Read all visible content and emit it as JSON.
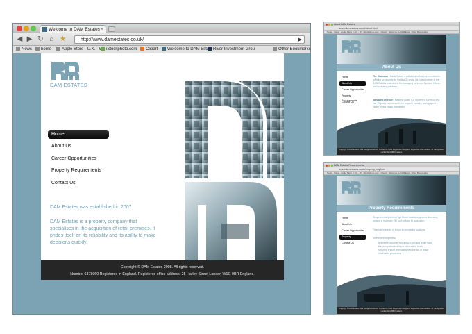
{
  "browser": {
    "tab_title": "Welcome to DAM Estates",
    "url": "http://www.damestates.co.uk/",
    "bookmarks": [
      "News",
      "home",
      "Apple Store - U.K. - W",
      "iStockphoto.com",
      "Clipart",
      "Welcome to DAM Esta",
      "River Investment Grou",
      "Other Bookmarks"
    ]
  },
  "site": {
    "logo_text": "DAM ESTATES",
    "nav": [
      {
        "label": "Home",
        "active": true
      },
      {
        "label": "About Us"
      },
      {
        "label": "Career Opportunities"
      },
      {
        "label": "Property Requirements"
      },
      {
        "label": "Contact Us"
      }
    ],
    "established": "DAM Estates was established in 2007.",
    "description": "DAM Estates is a property company that specialises in the acquisition of retail premises. It prides itself on its reliability and its ability to make decisions quickly.",
    "footer_copyright": "Copyright © DAM Estates 2008. All rights reserved.",
    "footer_registration": "Number 6378060 Registered in England. Registered office address: 25 Harley Street London W1G 9BR England."
  },
  "about_window": {
    "tab_title": "About DAM Estates",
    "url": "www.damestates.co.uk/about.html",
    "heading": "About Us",
    "nav": [
      "Home",
      "About Us",
      "Career Opportunities",
      "Property Requirements",
      "Contact Us"
    ],
    "active_index": 1,
    "para1_title": "The Chairman",
    "para1": "- David Spicer, a solicitor who has been involved in advising on property for the last 30 years. He is and partner in the DAM Estates retail and is the managing partner of Spencer Halpen and its related practices.",
    "para2_title": "Managing Director",
    "para2": "- Matthew Alasti, is a Chartered Surveyor and has 15 years experience in the property industry, having spent a career in real estate investment.",
    "footer": "Copyright © DAM Estates 2008. All rights reserved. Number 6378060 Registered in England. Registered office address: 25 Harley Street London W1G 9BR England."
  },
  "requirements_window": {
    "tab_title": "DAM Estates Requirements",
    "url": "www.damestates.co.uk/property_req.html",
    "heading": "Property Requirements",
    "nav": [
      "Home",
      "About Us",
      "Career Opportunities",
      "Property Requirements",
      "Contact Us"
    ],
    "active_index": 3,
    "bullets": [
      "Shops in retail pitch in High Street locations, ground floor shop units of a minimum 750 sq ft subject to population.",
      "Freehold interests of shops in secondary locations.",
      "Investment properties:"
    ],
    "sub_bullets": [
      "where the occupier is looking to sell and lease back",
      "the occupier is looking to re-locate in stock",
      "securing a short term unexpired licence or lease",
      "retail rated properties"
    ],
    "footer": "Copyright © DAM Estates 2008. All rights reserved. Number 6378060 Registered in England. Registered office address: 25 Harley Street London W1G 9BR England."
  },
  "colors": {
    "teal_background": "#7ba3b3",
    "accent_text": "#6f9fb2",
    "footer_bg": "#262626"
  }
}
